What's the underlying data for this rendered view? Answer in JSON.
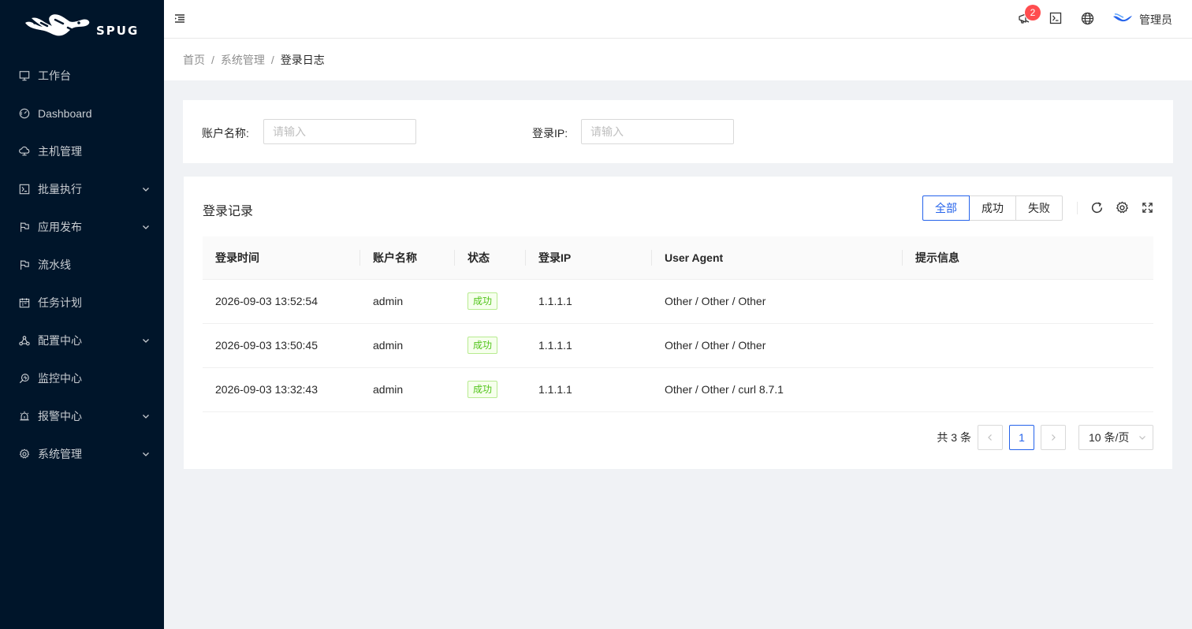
{
  "brand": {
    "name": "SPUG"
  },
  "sidebar": {
    "items": [
      {
        "label": "工作台",
        "icon": "desktop-icon",
        "has_arrow": false
      },
      {
        "label": "Dashboard",
        "icon": "dashboard-icon",
        "has_arrow": false
      },
      {
        "label": "主机管理",
        "icon": "cloud-server-icon",
        "has_arrow": false
      },
      {
        "label": "批量执行",
        "icon": "code-icon",
        "has_arrow": true
      },
      {
        "label": "应用发布",
        "icon": "flag-icon",
        "has_arrow": true
      },
      {
        "label": "流水线",
        "icon": "flag-icon",
        "has_arrow": false
      },
      {
        "label": "任务计划",
        "icon": "schedule-icon",
        "has_arrow": false
      },
      {
        "label": "配置中心",
        "icon": "deployment-icon",
        "has_arrow": true
      },
      {
        "label": "监控中心",
        "icon": "monitor-icon",
        "has_arrow": false
      },
      {
        "label": "报警中心",
        "icon": "alert-icon",
        "has_arrow": true
      },
      {
        "label": "系统管理",
        "icon": "setting-icon",
        "has_arrow": true
      }
    ]
  },
  "header": {
    "notification_count": "2",
    "user_name": "管理员"
  },
  "breadcrumb": [
    "首页",
    "系统管理",
    "登录日志"
  ],
  "filters": {
    "account_label": "账户名称:",
    "account_placeholder": "请输入",
    "ip_label": "登录IP:",
    "ip_placeholder": "请输入"
  },
  "table_card": {
    "title": "登录记录",
    "status_filter": [
      "全部",
      "成功",
      "失败"
    ],
    "active_filter": "全部",
    "columns": [
      "登录时间",
      "账户名称",
      "状态",
      "登录IP",
      "User Agent",
      "提示信息"
    ],
    "rows": [
      {
        "time": "2026-09-03 13:52:54",
        "account": "admin",
        "status": "成功",
        "ip": "1.1.1.1",
        "agent": "Other / Other / Other",
        "message": ""
      },
      {
        "time": "2026-09-03 13:50:45",
        "account": "admin",
        "status": "成功",
        "ip": "1.1.1.1",
        "agent": "Other / Other / Other",
        "message": ""
      },
      {
        "time": "2026-09-03 13:32:43",
        "account": "admin",
        "status": "成功",
        "ip": "1.1.1.1",
        "agent": "Other / Other / curl 8.7.1",
        "message": ""
      }
    ]
  },
  "pagination": {
    "total_text": "共 3 条",
    "current_page": "1",
    "page_size": "10 条/页"
  },
  "colors": {
    "sidebar_bg": "#00152a",
    "primary": "#2563eb",
    "success": "#52c41a",
    "badge": "#ff4d4f"
  }
}
